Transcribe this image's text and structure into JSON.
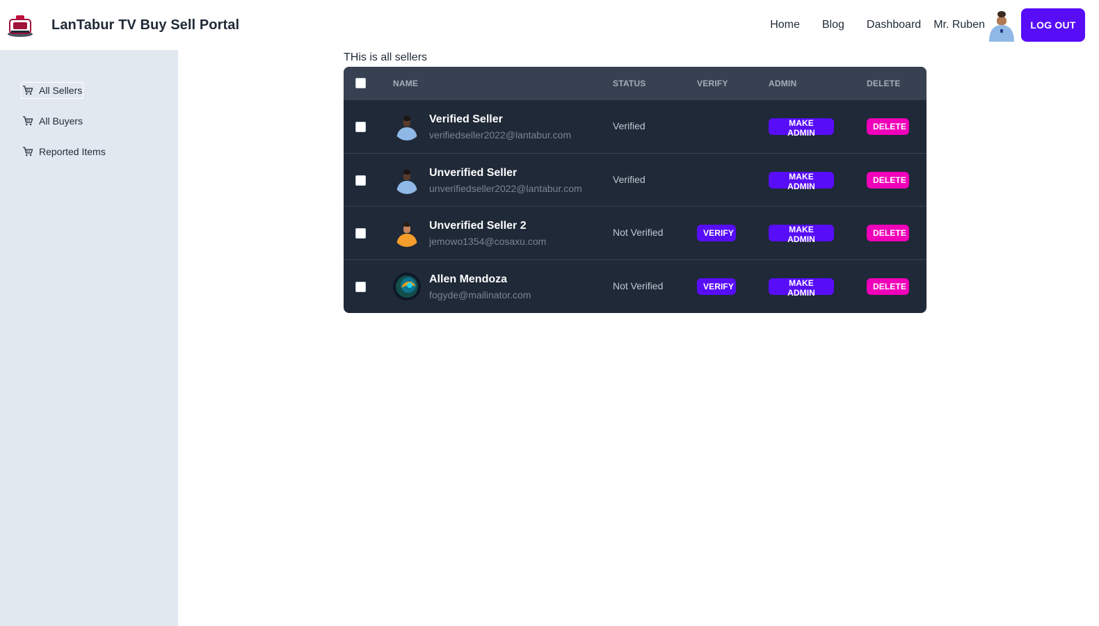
{
  "brand": {
    "title": "LanTabur TV Buy Sell Portal"
  },
  "nav": {
    "links": [
      "Home",
      "Blog",
      "Dashboard"
    ],
    "user_name": "Mr. Ruben",
    "logout_label": "LOG OUT"
  },
  "sidebar": {
    "items": [
      {
        "label": "All Sellers",
        "icon": "cart-icon",
        "active": true
      },
      {
        "label": "All Buyers",
        "icon": "cart-icon",
        "active": false
      },
      {
        "label": "Reported Items",
        "icon": "cart-icon",
        "active": false
      }
    ]
  },
  "main": {
    "heading": "THis is all sellers",
    "columns": [
      "Name",
      "Status",
      "Verify",
      "Admin",
      "Delete"
    ],
    "rows": [
      {
        "name": "Verified Seller",
        "email": "verifiedseller2022@lantabur.com",
        "status": "Verified",
        "verify_label": "",
        "admin_label": "MAKE ADMIN",
        "delete_label": "DELETE",
        "avatar": "player-blue-kit"
      },
      {
        "name": "Unverified Seller",
        "email": "unverifiedseller2022@lantabur.com",
        "status": "Verified",
        "verify_label": "",
        "admin_label": "MAKE ADMIN",
        "delete_label": "DELETE",
        "avatar": "player-blue-kit"
      },
      {
        "name": "Unverified Seller 2",
        "email": "jemowo1354@cosaxu.com",
        "status": "Not Verified",
        "verify_label": "VERIFY",
        "admin_label": "MAKE ADMIN",
        "delete_label": "DELETE",
        "avatar": "player-orange-kit"
      },
      {
        "name": "Allen Mendoza",
        "email": "fogyde@mailinator.com",
        "status": "Not Verified",
        "verify_label": "VERIFY",
        "admin_label": "MAKE ADMIN",
        "delete_label": "DELETE",
        "avatar": "abstract-orb"
      }
    ]
  },
  "colors": {
    "primary": "#570df8",
    "secondary": "#f000b8",
    "sidebar_bg": "#e2e8f0",
    "table_bg": "#1f2937",
    "table_header_bg": "#374151"
  }
}
